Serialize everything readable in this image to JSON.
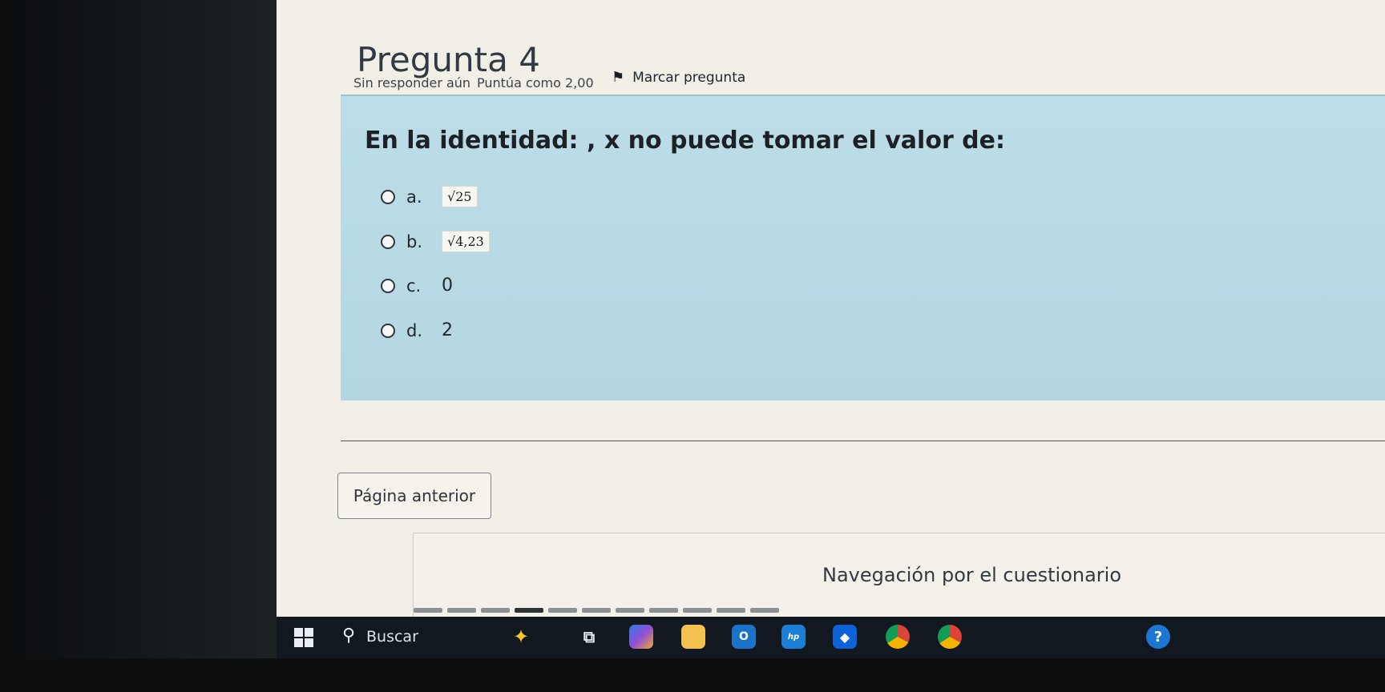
{
  "question": {
    "title": "Pregunta 4",
    "status": "Sin responder aún",
    "grade": "Puntúa como 2,00",
    "flag_label": "Marcar pregunta",
    "text": "En la identidad: , x no puede tomar el valor de:"
  },
  "options": [
    {
      "letter": "a.",
      "value": "√25"
    },
    {
      "letter": "b.",
      "value": "√4,23"
    },
    {
      "letter": "c.",
      "value": "0"
    },
    {
      "letter": "d.",
      "value": "2"
    }
  ],
  "buttons": {
    "previous": "Página anterior"
  },
  "navigation": {
    "title": "Navegación por el cuestionario"
  },
  "taskbar": {
    "search_label": "Buscar",
    "icons": [
      "windows-start-icon",
      "search-icon",
      "copilot-icon",
      "task-view-icon",
      "copilot-app-icon",
      "file-explorer-icon",
      "outlook-icon",
      "myhp-icon",
      "dropbox-icon",
      "chrome-icon",
      "chrome-profile-icon",
      "help-icon"
    ]
  },
  "colors": {
    "question_bg": "#bcdde8",
    "page_bg": "#f1efe6",
    "taskbar_bg": "#121820"
  }
}
